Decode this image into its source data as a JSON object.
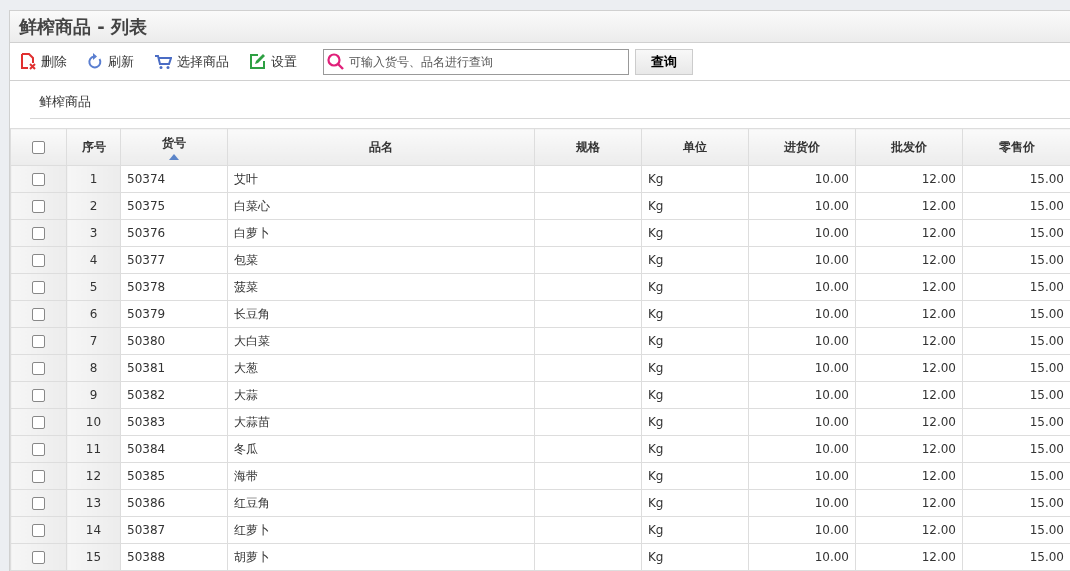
{
  "title": "鲜榨商品 - 列表",
  "toolbar": [
    {
      "kind": "delete",
      "label": "删除"
    },
    {
      "kind": "refresh",
      "label": "刷新"
    },
    {
      "kind": "cart",
      "label": "选择商品"
    },
    {
      "kind": "edit",
      "label": "设置"
    }
  ],
  "search": {
    "placeholder": "可输入货号、品名进行查询",
    "button": "查询"
  },
  "tab": {
    "label": "鲜榨商品"
  },
  "table": {
    "select_all_checked": false,
    "columns": [
      {
        "label": "序号",
        "sorted": false
      },
      {
        "label": "货号",
        "sorted": true
      },
      {
        "label": "品名",
        "sorted": false
      },
      {
        "label": "规格",
        "sorted": false
      },
      {
        "label": "单位",
        "sorted": false
      },
      {
        "label": "进货价",
        "sorted": false
      },
      {
        "label": "批发价",
        "sorted": false
      },
      {
        "label": "零售价",
        "sorted": false
      }
    ],
    "rows": [
      {
        "checked": false,
        "cells": [
          "1",
          "50374",
          "艾叶",
          "",
          "Kg",
          "10.00",
          "12.00",
          "15.00"
        ]
      },
      {
        "checked": false,
        "cells": [
          "2",
          "50375",
          "白菜心",
          "",
          "Kg",
          "10.00",
          "12.00",
          "15.00"
        ]
      },
      {
        "checked": false,
        "cells": [
          "3",
          "50376",
          "白萝卜",
          "",
          "Kg",
          "10.00",
          "12.00",
          "15.00"
        ]
      },
      {
        "checked": false,
        "cells": [
          "4",
          "50377",
          "包菜",
          "",
          "Kg",
          "10.00",
          "12.00",
          "15.00"
        ]
      },
      {
        "checked": false,
        "cells": [
          "5",
          "50378",
          "菠菜",
          "",
          "Kg",
          "10.00",
          "12.00",
          "15.00"
        ]
      },
      {
        "checked": false,
        "cells": [
          "6",
          "50379",
          "长豆角",
          "",
          "Kg",
          "10.00",
          "12.00",
          "15.00"
        ]
      },
      {
        "checked": false,
        "cells": [
          "7",
          "50380",
          "大白菜",
          "",
          "Kg",
          "10.00",
          "12.00",
          "15.00"
        ]
      },
      {
        "checked": false,
        "cells": [
          "8",
          "50381",
          "大葱",
          "",
          "Kg",
          "10.00",
          "12.00",
          "15.00"
        ]
      },
      {
        "checked": false,
        "cells": [
          "9",
          "50382",
          "大蒜",
          "",
          "Kg",
          "10.00",
          "12.00",
          "15.00"
        ]
      },
      {
        "checked": false,
        "cells": [
          "10",
          "50383",
          "大蒜苗",
          "",
          "Kg",
          "10.00",
          "12.00",
          "15.00"
        ]
      },
      {
        "checked": false,
        "cells": [
          "11",
          "50384",
          "冬瓜",
          "",
          "Kg",
          "10.00",
          "12.00",
          "15.00"
        ]
      },
      {
        "checked": false,
        "cells": [
          "12",
          "50385",
          "海带",
          "",
          "Kg",
          "10.00",
          "12.00",
          "15.00"
        ]
      },
      {
        "checked": false,
        "cells": [
          "13",
          "50386",
          "红豆角",
          "",
          "Kg",
          "10.00",
          "12.00",
          "15.00"
        ]
      },
      {
        "checked": false,
        "cells": [
          "14",
          "50387",
          "红萝卜",
          "",
          "Kg",
          "10.00",
          "12.00",
          "15.00"
        ]
      },
      {
        "checked": false,
        "cells": [
          "15",
          "50388",
          "胡萝卜",
          "",
          "Kg",
          "10.00",
          "12.00",
          "15.00"
        ]
      }
    ]
  }
}
